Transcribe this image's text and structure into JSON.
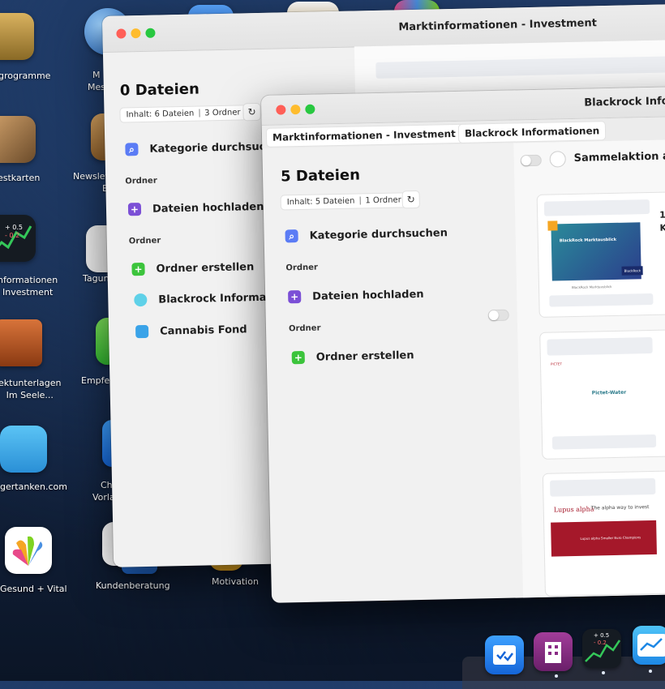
{
  "desktop": {
    "icons": [
      {
        "label": "grogramme",
        "lines": [
          "grogramme"
        ]
      },
      {
        "label": "M\nMess",
        "lines": [
          "M",
          "Mess"
        ]
      },
      {
        "label": "estkarten",
        "lines": [
          "estkarten"
        ]
      },
      {
        "label": "Newslet E",
        "lines": [
          "Newslet",
          "E"
        ]
      },
      {
        "label": "nformationen Investment",
        "lines": [
          "nformationen",
          "Investment"
        ]
      },
      {
        "label": "Tagung",
        "lines": [
          "Tagung"
        ]
      },
      {
        "label": "ektunterlagen Im Seele...",
        "lines": [
          "ektunterlagen",
          "Im Seele..."
        ]
      },
      {
        "label": "Empfehl",
        "lines": [
          "Empfehl"
        ]
      },
      {
        "label": "gertanken.com",
        "lines": [
          "gertanken.com"
        ]
      },
      {
        "label": "Chec Vorlag",
        "lines": [
          "Chec",
          "Vorlag"
        ]
      },
      {
        "label": "Gesund + Vital",
        "lines": [
          "Gesund + Vital"
        ]
      },
      {
        "label": "Kundenberatung",
        "lines": [
          "Kundenberatung"
        ]
      },
      {
        "label": "Motivation",
        "lines": [
          "Motivation"
        ]
      }
    ],
    "chart_icon_values": {
      "up": "+ 0.5",
      "down": "- 0.2"
    }
  },
  "window_back": {
    "title": "Marktinformationen - Investment",
    "count": "0 Dateien",
    "chip": {
      "files": "Inhalt: 6 Dateien",
      "folders": "3 Ordner"
    },
    "search": "Kategorie durchsuchen",
    "section1": "Ordner",
    "upload": "Dateien hochladen",
    "section2": "Ordner",
    "create": "Ordner erstellen",
    "folders": [
      "Blackrock Informationen",
      "Cannabis Fond"
    ]
  },
  "window_front": {
    "title": "Blackrock Informationen",
    "breadcrumb": [
      "Marktinformationen - Investment",
      "Blackrock Informationen"
    ],
    "count": "5 Dateien",
    "chip": {
      "files": "Inhalt: 5 Dateien",
      "folders": "1 Ordner"
    },
    "search": "Kategorie durchsuchen",
    "section1": "Ordner",
    "upload": "Dateien hochladen",
    "section2": "Ordner",
    "create": "Ordner erstellen",
    "bulk_action": "Sammelaktion a",
    "right_fragment": "1\nK",
    "cards": [
      {
        "heading": "BlackRock Marktausblick",
        "badge": "BlackRock",
        "footer": "BlackRock Marktausblick"
      },
      {
        "heading": "Pictet-Water",
        "subheading": "PICTET"
      },
      {
        "heading": "Lupus alpha",
        "tagline": "The alpha way to invest",
        "sub": "Lupus alpha Smaller Euro Champions"
      }
    ]
  },
  "dock": {
    "items": [
      "checklist",
      "buildings",
      "stocks",
      "chart"
    ],
    "stock_values": {
      "up": "+ 0.5",
      "down": "- 0.2"
    }
  },
  "colors": {
    "close": "#ff5f57",
    "minimize": "#febc2e",
    "zoom": "#28c840",
    "search": "#5b7cf5",
    "upload": "#7b4fd6",
    "create": "#3cc43c",
    "folder": "#3aa3e8"
  }
}
